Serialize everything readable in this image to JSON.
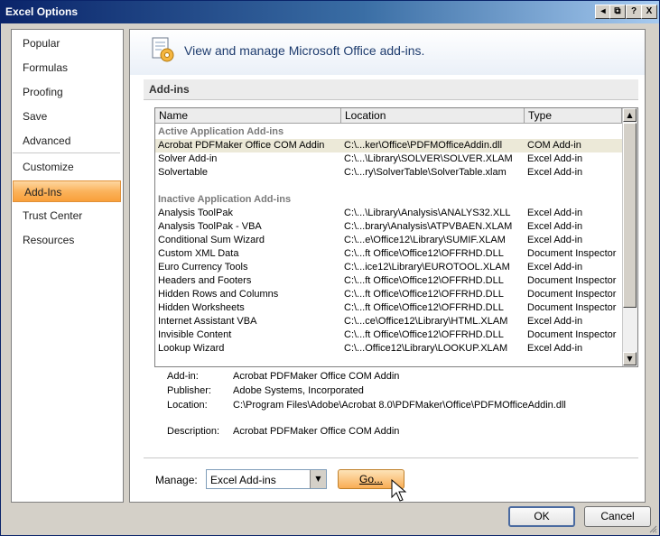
{
  "window": {
    "title": "Excel Options",
    "buttons": [
      "◂",
      "⧉",
      "?",
      "X"
    ]
  },
  "nav": {
    "items": [
      {
        "label": "Popular"
      },
      {
        "label": "Formulas"
      },
      {
        "label": "Proofing"
      },
      {
        "label": "Save"
      },
      {
        "label": "Advanced"
      },
      {
        "label": "Customize"
      },
      {
        "label": "Add-Ins",
        "selected": true
      },
      {
        "label": "Trust Center"
      },
      {
        "label": "Resources"
      }
    ]
  },
  "header": {
    "text": "View and manage Microsoft Office add-ins.",
    "icon": "addins-gear-icon"
  },
  "section": {
    "title": "Add-ins"
  },
  "table": {
    "columns": [
      "Name",
      "Location",
      "Type"
    ],
    "groups": {
      "active": "Active Application Add-ins",
      "inactive": "Inactive Application Add-ins"
    },
    "active": [
      {
        "name": "Acrobat PDFMaker Office COM Addin",
        "location": "C:\\...ker\\Office\\PDFMOfficeAddin.dll",
        "type": "COM Add-in",
        "selected": true
      },
      {
        "name": "Solver Add-in",
        "location": "C:\\...\\Library\\SOLVER\\SOLVER.XLAM",
        "type": "Excel Add-in"
      },
      {
        "name": "Solvertable",
        "location": "C:\\...ry\\SolverTable\\SolverTable.xlam",
        "type": "Excel Add-in"
      }
    ],
    "inactive": [
      {
        "name": "Analysis ToolPak",
        "location": "C:\\...\\Library\\Analysis\\ANALYS32.XLL",
        "type": "Excel Add-in"
      },
      {
        "name": "Analysis ToolPak - VBA",
        "location": "C:\\...brary\\Analysis\\ATPVBAEN.XLAM",
        "type": "Excel Add-in"
      },
      {
        "name": "Conditional Sum Wizard",
        "location": "C:\\...e\\Office12\\Library\\SUMIF.XLAM",
        "type": "Excel Add-in"
      },
      {
        "name": "Custom XML Data",
        "location": "C:\\...ft Office\\Office12\\OFFRHD.DLL",
        "type": "Document Inspector"
      },
      {
        "name": "Euro Currency Tools",
        "location": "C:\\...ice12\\Library\\EUROTOOL.XLAM",
        "type": "Excel Add-in"
      },
      {
        "name": "Headers and Footers",
        "location": "C:\\...ft Office\\Office12\\OFFRHD.DLL",
        "type": "Document Inspector"
      },
      {
        "name": "Hidden Rows and Columns",
        "location": "C:\\...ft Office\\Office12\\OFFRHD.DLL",
        "type": "Document Inspector"
      },
      {
        "name": "Hidden Worksheets",
        "location": "C:\\...ft Office\\Office12\\OFFRHD.DLL",
        "type": "Document Inspector"
      },
      {
        "name": "Internet Assistant VBA",
        "location": "C:\\...ce\\Office12\\Library\\HTML.XLAM",
        "type": "Excel Add-in"
      },
      {
        "name": "Invisible Content",
        "location": "C:\\...ft Office\\Office12\\OFFRHD.DLL",
        "type": "Document Inspector"
      },
      {
        "name": "Lookup Wizard",
        "location": "C:\\...Office12\\Library\\LOOKUP.XLAM",
        "type": "Excel Add-in"
      }
    ]
  },
  "details": {
    "addin_label": "Add-in:",
    "addin": "Acrobat PDFMaker Office COM Addin",
    "publisher_label": "Publisher:",
    "publisher": "Adobe Systems, Incorporated",
    "location_label": "Location:",
    "location": "C:\\Program Files\\Adobe\\Acrobat 8.0\\PDFMaker\\Office\\PDFMOfficeAddin.dll",
    "description_label": "Description:",
    "description": "Acrobat PDFMaker Office COM Addin"
  },
  "manage": {
    "label": "Manage:",
    "selected": "Excel Add-ins",
    "go_label": "Go..."
  },
  "footer": {
    "ok_label": "OK",
    "cancel_label": "Cancel"
  },
  "colors": {
    "accent": "#f9a03a",
    "title_bar": "#0a246a"
  }
}
